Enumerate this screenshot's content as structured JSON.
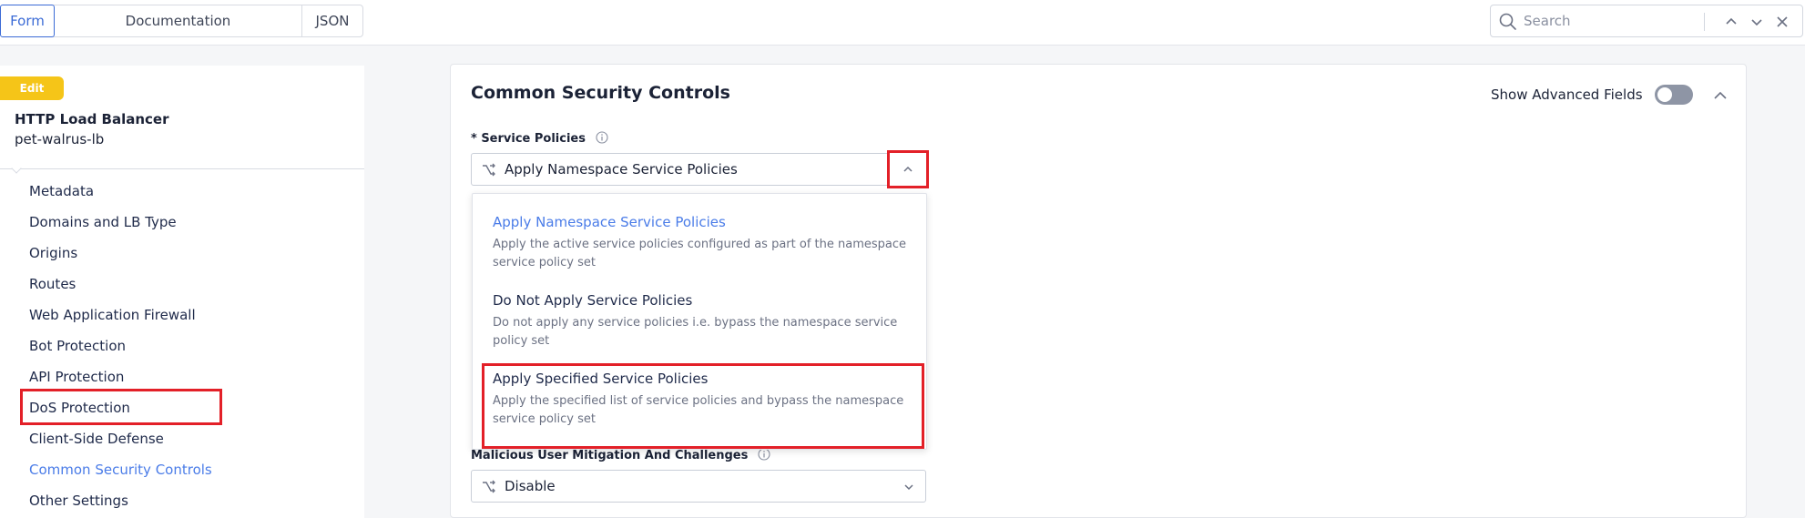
{
  "toolbar": {
    "tabs": [
      {
        "label": "Form",
        "active": true
      },
      {
        "label": "Documentation",
        "active": false
      },
      {
        "label": "JSON",
        "active": false
      }
    ],
    "search": {
      "placeholder": "Search",
      "value": ""
    }
  },
  "sidebar": {
    "badge": "Edit",
    "object_kind": "HTTP Load Balancer",
    "object_name": "pet-walrus-lb",
    "items": [
      {
        "label": "Metadata",
        "active": false
      },
      {
        "label": "Domains and LB Type",
        "active": false
      },
      {
        "label": "Origins",
        "active": false
      },
      {
        "label": "Routes",
        "active": false
      },
      {
        "label": "Web Application Firewall",
        "active": false
      },
      {
        "label": "Bot Protection",
        "active": false
      },
      {
        "label": "API Protection",
        "active": false
      },
      {
        "label": "DoS Protection",
        "active": false
      },
      {
        "label": "Client-Side Defense",
        "active": false
      },
      {
        "label": "Common Security Controls",
        "active": true
      },
      {
        "label": "Other Settings",
        "active": false
      }
    ]
  },
  "main": {
    "section_title": "Common Security Controls",
    "advanced_label": "Show Advanced Fields",
    "advanced_enabled": false,
    "service_policies": {
      "label": "* Service Policies",
      "value": "Apply Namespace Service Policies",
      "dropdown_open": true,
      "options": [
        {
          "title": "Apply Namespace Service Policies",
          "desc": "Apply the active service policies configured as part of the namespace service policy set",
          "selected": true
        },
        {
          "title": "Do Not Apply Service Policies",
          "desc": "Do not apply any service policies i.e. bypass the namespace service policy set",
          "selected": false
        },
        {
          "title": "Apply Specified Service Policies",
          "desc": "Apply the specified list of service policies and bypass the namespace service policy set",
          "selected": false
        }
      ]
    },
    "malicious_user": {
      "label": "Malicious User Mitigation And Challenges",
      "value": "Disable"
    }
  },
  "colors": {
    "accent": "#4a7ce8",
    "badge": "#f5c518",
    "highlight": "#e32028",
    "text": "#1b2236"
  }
}
